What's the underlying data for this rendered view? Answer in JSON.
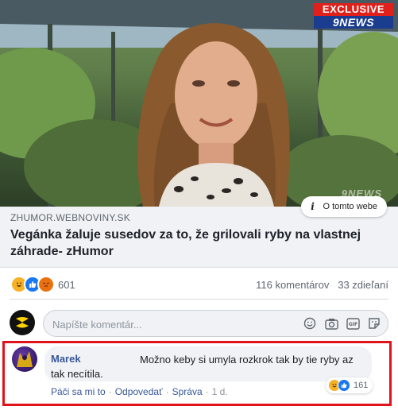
{
  "hero": {
    "badge_top": "EXCLUSIVE",
    "badge_bottom": "9NEWS",
    "watermark": "9NEWS",
    "info_label": "O tomto webe"
  },
  "link": {
    "domain": "ZHUMOR.WEBNOVINY.SK",
    "title": "Vegánka žaluje susedov za to, že grilovali ryby na vlastnej záhrade- zHumor"
  },
  "reactions": {
    "count": "601",
    "icons": [
      "haha-icon",
      "like-icon",
      "angry-icon"
    ],
    "comments_label": "116 komentárov",
    "shares_label": "33 zdieľaní"
  },
  "composer": {
    "placeholder": "Napíšte komentár...",
    "icons": [
      "emoji-icon",
      "camera-icon",
      "gif-icon",
      "sticker-icon"
    ]
  },
  "comment": {
    "author": "Marek",
    "text": "Možno keby si umyla rozkrok tak by tie ryby az tak necítila.",
    "reaction_count": "161",
    "actions": {
      "like": "Páči sa mi to",
      "reply": "Odpovedať",
      "message": "Správa",
      "time": "1 d."
    }
  },
  "colors": {
    "link_blue": "#385898",
    "highlight_red": "#e0121b",
    "like_blue": "#1877f2",
    "haha_yellow": "#f7b125",
    "angry_orange": "#e9710f"
  }
}
